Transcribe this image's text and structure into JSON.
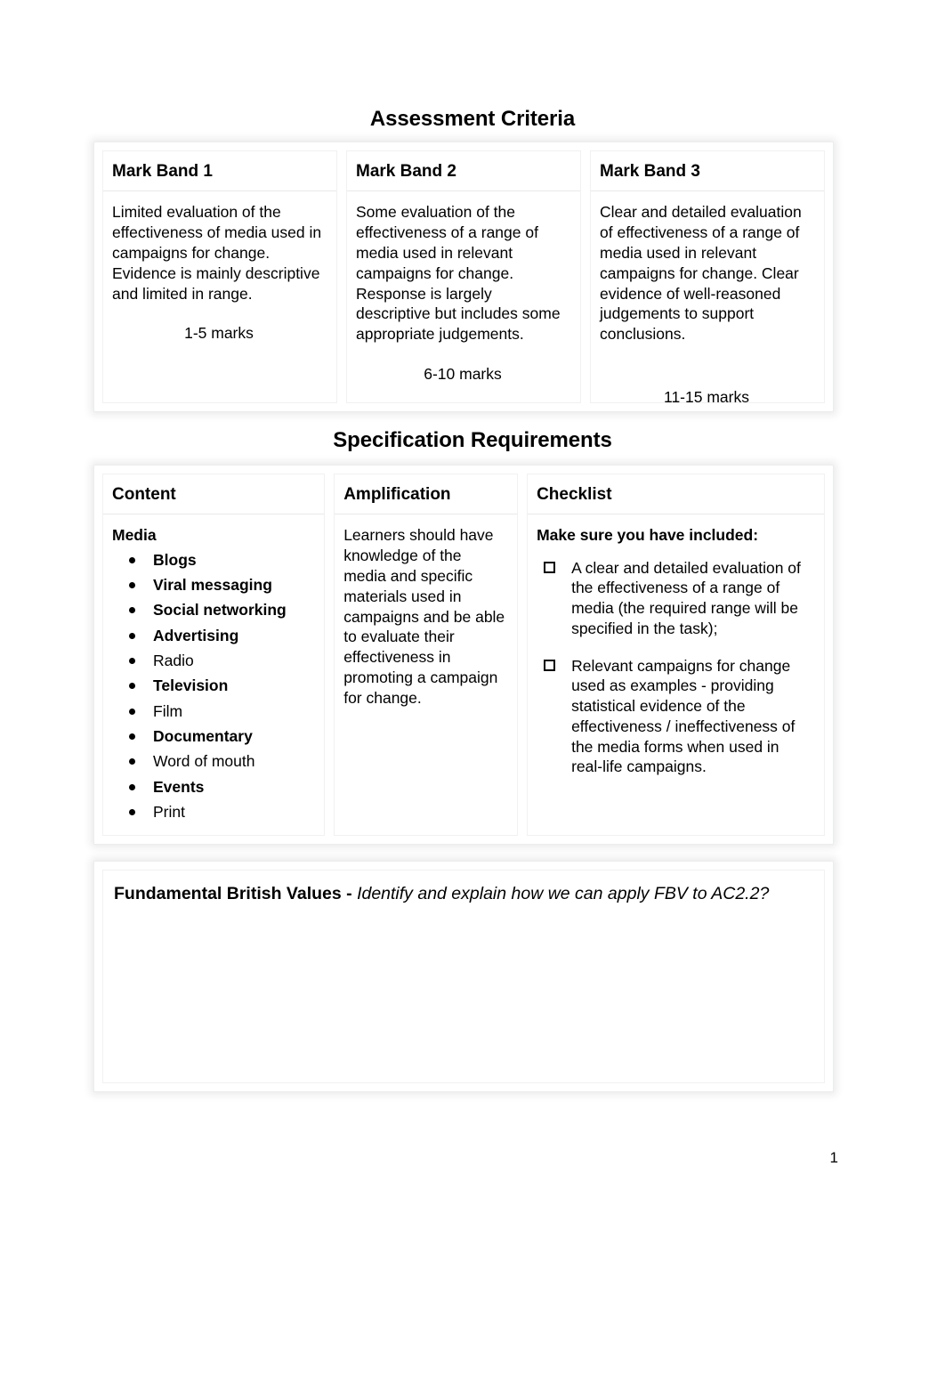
{
  "document": {
    "page_number": "1"
  },
  "assessment": {
    "title": "Assessment Criteria",
    "columns": [
      {
        "header": "Mark Band 1",
        "body": "Limited evaluation of the effectiveness of media used in campaigns for change. Evidence is mainly descriptive and limited in range.",
        "marks": "1-5 marks"
      },
      {
        "header": "Mark Band 2",
        "body": "Some evaluation of the effectiveness of a range of media used in relevant campaigns for change. Response is largely descriptive but includes some appropriate judgements.",
        "marks": "6-10 marks"
      },
      {
        "header": "Mark Band 3",
        "body": "Clear and detailed evaluation of effectiveness of a range of media used in relevant campaigns for change. Clear evidence of well-reasoned judgements to support conclusions.",
        "marks": "11-15 marks"
      }
    ]
  },
  "specification": {
    "title": "Specification Requirements",
    "headers": {
      "content": "Content",
      "amplification": "Amplification",
      "checklist": "Checklist"
    },
    "content": {
      "subheading": "Media",
      "items": [
        {
          "label": "Blogs",
          "bold": true
        },
        {
          "label": "Viral messaging",
          "bold": true
        },
        {
          "label": "Social networking",
          "bold": true
        },
        {
          "label": "Advertising",
          "bold": true
        },
        {
          "label": "Radio",
          "bold": false
        },
        {
          "label": "Television",
          "bold": true
        },
        {
          "label": "Film",
          "bold": false
        },
        {
          "label": "Documentary",
          "bold": true
        },
        {
          "label": "Word of mouth",
          "bold": false
        },
        {
          "label": "Events",
          "bold": true
        },
        {
          "label": "Print",
          "bold": false
        }
      ]
    },
    "amplification": {
      "text": "Learners should have knowledge of the media and specific materials used in campaigns and be able to evaluate their effectiveness in promoting a campaign for change."
    },
    "checklist": {
      "subheading": "Make sure you have included:",
      "items": [
        "A clear and detailed evaluation of the effectiveness of a range of media (the required range will be specified in the task);",
        "Relevant campaigns for change used as examples - providing statistical evidence of the effectiveness / ineffectiveness of the media forms when used in real-life campaigns."
      ]
    }
  },
  "fbv": {
    "label": "Fundamental British Values - ",
    "question": "Identify and explain how we can apply FBV to AC2.2?",
    "answer": ""
  }
}
